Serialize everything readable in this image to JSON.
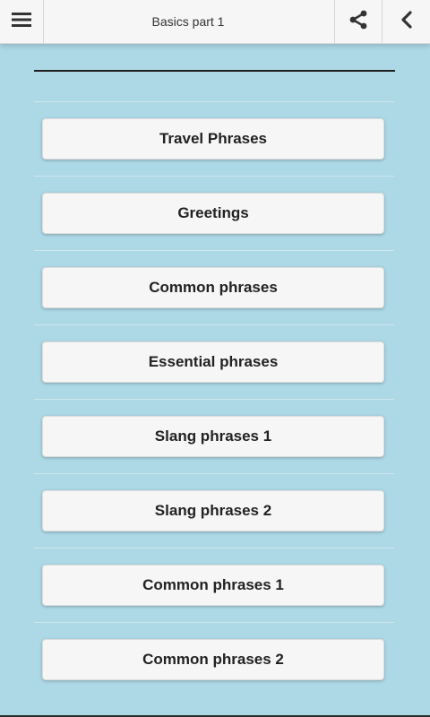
{
  "header": {
    "title": "Basics part 1",
    "menu_icon": "menu-icon",
    "share_icon": "share-icon",
    "back_icon": "chevron-left-icon"
  },
  "colors": {
    "background": "#add8e6",
    "header_background": "#f6f6f6",
    "button_background": "#f6f6f6",
    "button_text": "#222222"
  },
  "menu": {
    "items": [
      {
        "label": "Travel Phrases"
      },
      {
        "label": "Greetings"
      },
      {
        "label": "Common phrases"
      },
      {
        "label": "Essential phrases"
      },
      {
        "label": "Slang phrases 1"
      },
      {
        "label": "Slang phrases 2"
      },
      {
        "label": "Common phrases 1"
      },
      {
        "label": "Common phrases 2"
      }
    ]
  }
}
